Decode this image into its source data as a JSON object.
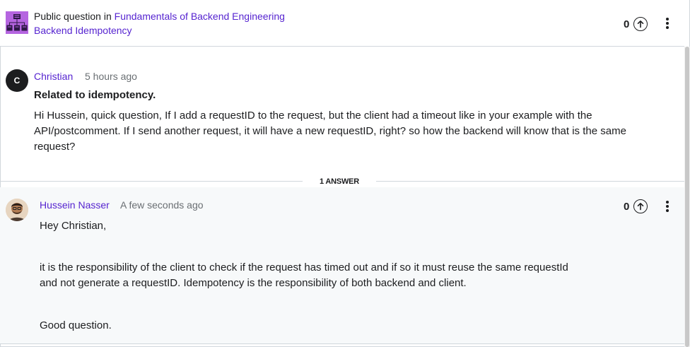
{
  "header": {
    "public_question_prefix": "Public question in",
    "course_name": "Fundamentals of Backend Engineering",
    "lecture_name": "Backend Idempotency",
    "vote_count": "0"
  },
  "question": {
    "avatar_initial": "C",
    "author": "Christian",
    "time": "5 hours ago",
    "title": "Related to idempotency.",
    "body": "Hi Hussein, quick question, If I add a requestID to the request, but the client had a timeout like in your example with the API/postcomment. If I send another request, it will have a new requestID, right? so how the backend will know that is the same request?"
  },
  "answers_label": "1 ANSWER",
  "answer": {
    "author": "Hussein Nasser",
    "time": "A few seconds ago",
    "vote_count": "0",
    "paragraphs": [
      "Hey Christian,",
      "it is the responsibility of the client to check if the request has timed out and if so it must reuse the same requestId and not generate a requestID. Idempotency is the responsibility of both backend and client.",
      "Good question."
    ]
  },
  "icons": {
    "course_thumbnail": "server-hierarchy-icon",
    "upvote": "arrow-up-circle-icon",
    "more": "vertical-dots-icon"
  },
  "colors": {
    "link": "#5624d0",
    "text": "#1c1d1f",
    "muted": "#6a6f73",
    "course_thumb_bg": "#b565e0",
    "answer_bg": "#f7f9fa"
  }
}
